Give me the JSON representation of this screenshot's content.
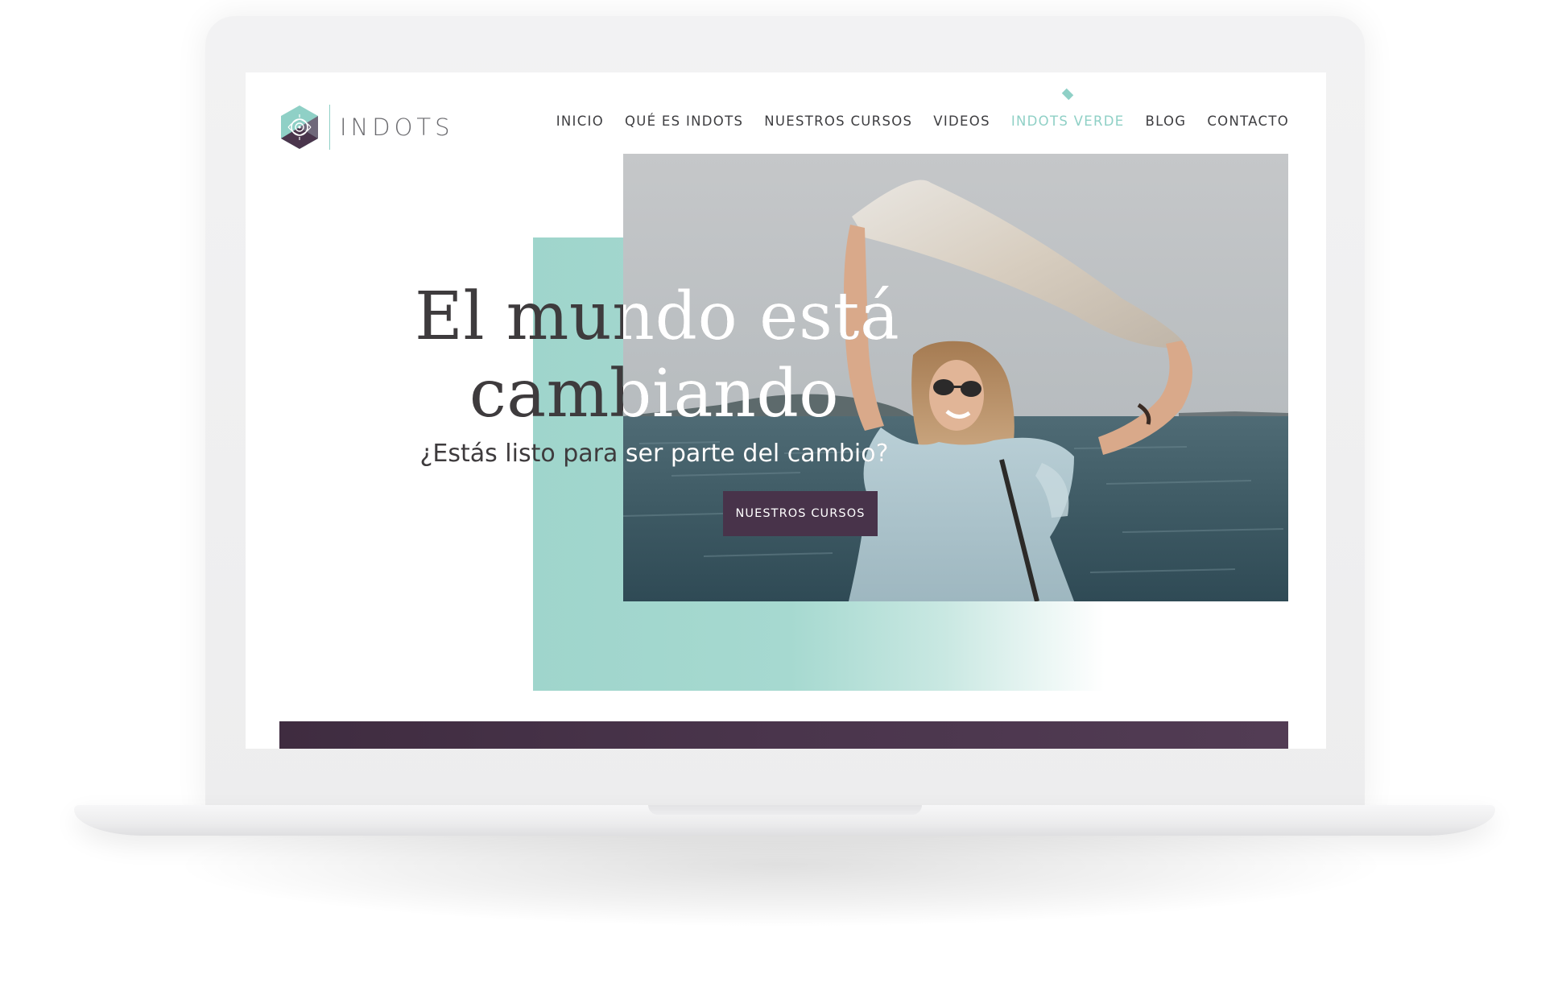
{
  "logo": {
    "text": "INDOTS"
  },
  "nav": {
    "items": [
      {
        "label": "INICIO"
      },
      {
        "label": "QUÉ ES INDOTS"
      },
      {
        "label": "NUESTROS CURSOS"
      },
      {
        "label": "VIDEOS"
      },
      {
        "label": "INDOTS VERDE",
        "active": true
      },
      {
        "label": "BLOG"
      },
      {
        "label": "CONTACTO"
      }
    ]
  },
  "hero": {
    "title_line1": "El mundo está",
    "title_line2": "cambiando",
    "subtitle": "¿Estás listo para ser parte del cambio?",
    "cta_label": "NUESTROS CURSOS"
  },
  "colors": {
    "accent_teal": "#8fd0c6",
    "brand_purple": "#48334a",
    "text_dark": "#3e3b3d"
  },
  "icons": {
    "logo_mark": "hexagon-mandala-icon",
    "active_marker": "diamond-icon"
  }
}
